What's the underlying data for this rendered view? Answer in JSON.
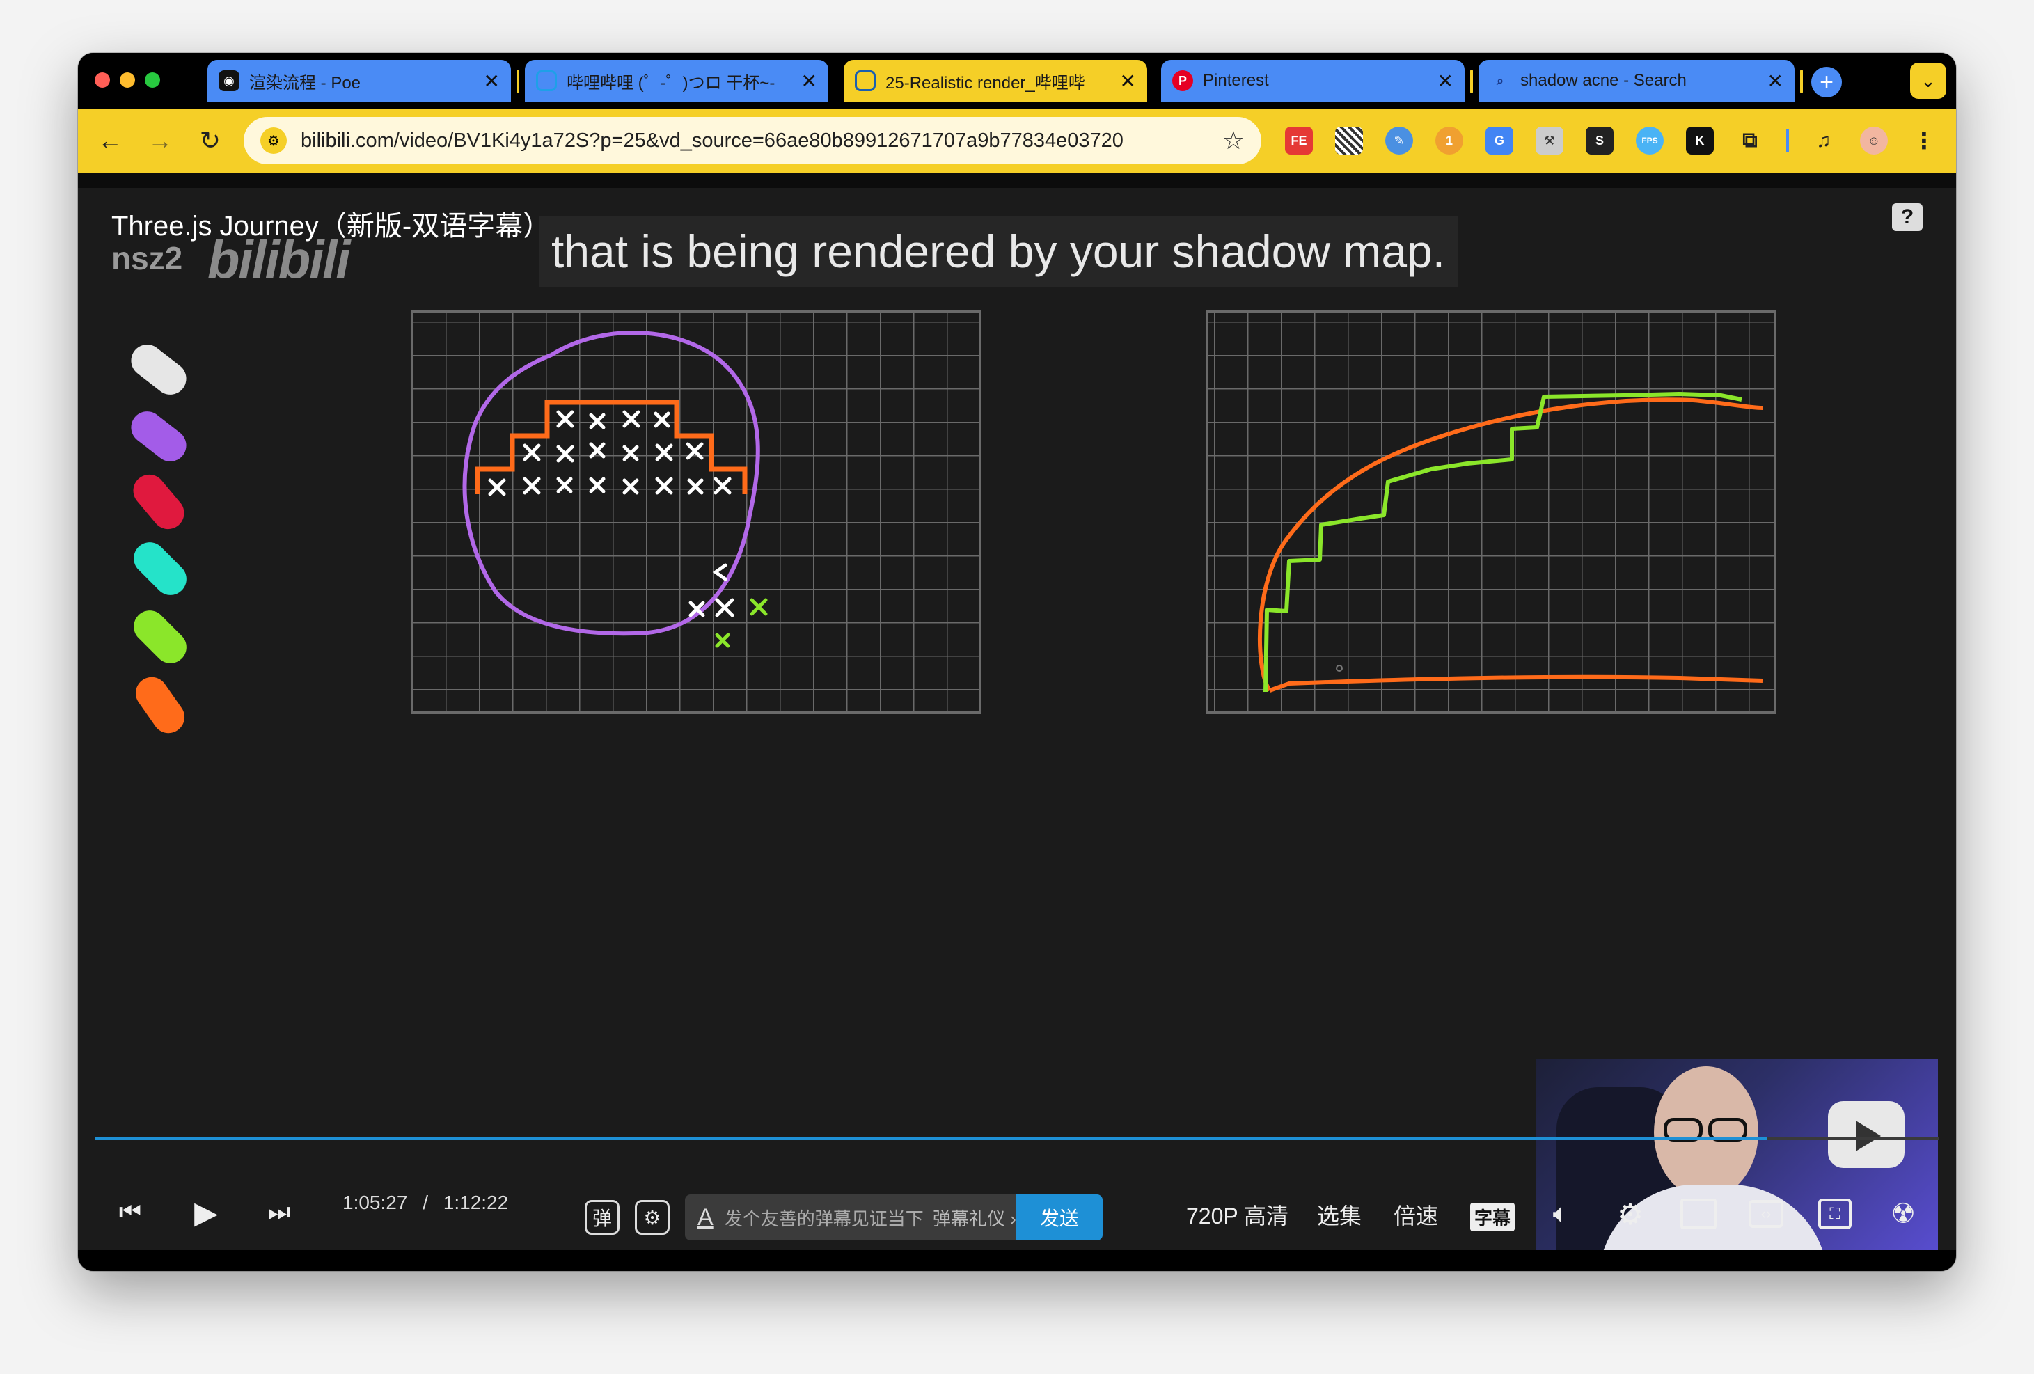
{
  "browser": {
    "tabs": [
      {
        "title": "渲染流程 - Poe",
        "favicon": "poe-icon"
      },
      {
        "title": "哔哩哔哩 (゜-゜)つロ 干杯~-",
        "favicon": "bilibili-tv-icon"
      },
      {
        "title": "25-Realistic render_哔哩哔",
        "favicon": "bilibili-tv-icon",
        "active": true
      },
      {
        "title": "Pinterest",
        "favicon": "pinterest-icon"
      },
      {
        "title": "shadow acne - Search",
        "favicon": "search-icon"
      }
    ],
    "tab_close": "✕",
    "new_tab": "+",
    "url": "bilibili.com/video/BV1Ki4y1a72S?p=25&vd_source=66ae80b89912671707a9b77834e03720",
    "extensions": [
      "FE",
      "QR",
      "S",
      "FPS",
      "K"
    ],
    "accent_color": "#f5cf27"
  },
  "video": {
    "title": "Three.js Journey（新版-双语字幕）",
    "watermark_user": "nsz2",
    "watermark_logo": "bilibili",
    "subtitle": "that is being rendered by your shadow map.",
    "help": "?",
    "pen_colors": [
      "#e6e6e6",
      "#a35ce8",
      "#e0193e",
      "#25e3c9",
      "#8be62a",
      "#ff6b1a"
    ],
    "progress": 0.9068
  },
  "player": {
    "current_time": "1:05:27",
    "separator": "/",
    "total_time": "1:12:22",
    "danmaku_placeholder": "发个友善的弹幕见证当下",
    "danmaku_etiquette": "弹幕礼仪 ›",
    "send_label": "发送",
    "quality": "720P 高清",
    "episodes": "选集",
    "speed": "倍速",
    "subtitles": "字幕"
  }
}
